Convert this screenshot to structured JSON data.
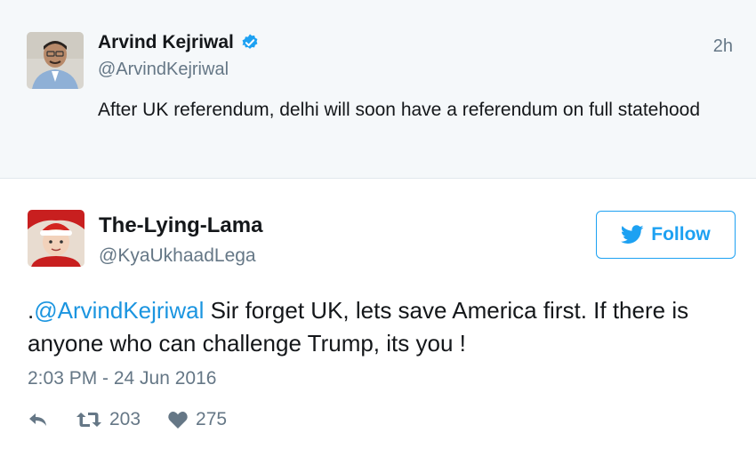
{
  "parent_tweet": {
    "name": "Arvind Kejriwal",
    "handle": "@ArvindKejriwal",
    "time": "2h",
    "text": "After UK referendum, delhi will soon have a referendum on full statehood",
    "verified": true
  },
  "tweet": {
    "name": "The-Lying-Lama",
    "handle": "@KyaUkhaadLega",
    "follow_label": "Follow",
    "text_prefix": ".",
    "mention": "@ArvindKejriwal",
    "text_body": " Sir forget UK, lets save America first. If there is anyone who can challenge Trump, its you !",
    "date": "2:03 PM - 24 Jun 2016",
    "retweets": "203",
    "likes": "275"
  },
  "icons": {
    "verified": "verified-badge-icon",
    "follow": "twitter-bird-icon",
    "reply": "reply-icon",
    "retweet": "retweet-icon",
    "like": "heart-icon"
  },
  "colors": {
    "accent": "#1da1f2",
    "mention": "#1b95e0",
    "secondary_text": "#657786",
    "parent_bg": "#f5f8fa"
  }
}
